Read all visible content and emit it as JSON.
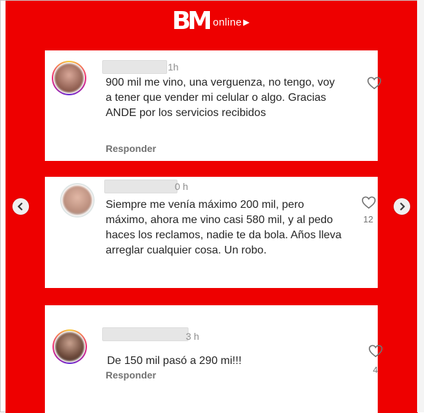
{
  "brand": {
    "mark": "BM",
    "word": "online",
    "play_glyph": "▶"
  },
  "comments": [
    {
      "time": "1h",
      "text": "900 mil me vino, una verguenza, no tengo, voy a tener que vender mi celular o algo. Gracias ANDE por los servicios recibidos",
      "reply_label": "Responder",
      "likes": ""
    },
    {
      "time": "0 h",
      "text": "Siempre me venía máximo 200 mil, pero máximo, ahora me vino casi 580 mil, y al pedo haces los reclamos, nadie te da bola. Años lleva arreglar cualquier cosa. Un robo.",
      "reply_label": "",
      "likes": "12"
    },
    {
      "time": "3 h",
      "text": "De 150 mil pasó a 290 mi!!!",
      "reply_label": "Responder",
      "likes": "4"
    }
  ],
  "nav": {
    "prev_icon": "chevron-left-icon",
    "next_icon": "chevron-right-icon"
  },
  "colors": {
    "background": "#ee0000",
    "card": "#ffffff",
    "text": "#262626",
    "muted": "#737373"
  }
}
